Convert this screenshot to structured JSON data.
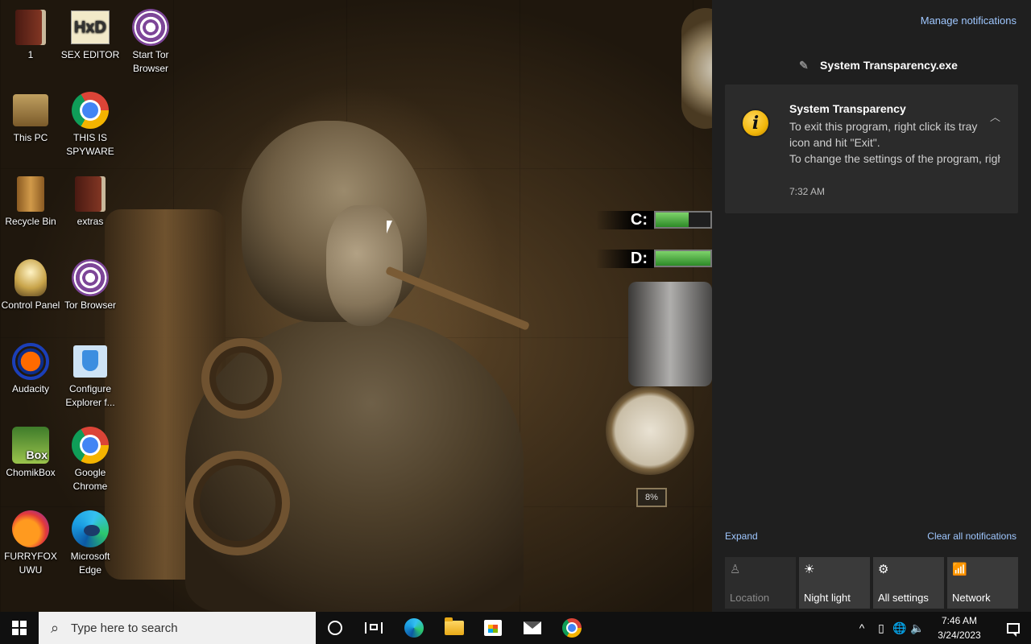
{
  "desktop": {
    "icons": [
      {
        "label": "1",
        "icon": "book-icon"
      },
      {
        "label": "SEX EDITOR",
        "icon": "hxd-icon",
        "glyph": "HxD"
      },
      {
        "label": "Start Tor Browser",
        "icon": "tor-icon"
      },
      {
        "label": "This PC",
        "icon": "computer-icon"
      },
      {
        "label": "THIS IS SPYWARE",
        "icon": "chrome-icon"
      },
      {
        "label": "Recycle Bin",
        "icon": "recycle-bin-icon"
      },
      {
        "label": "extras",
        "icon": "book-icon"
      },
      {
        "label": "Control Panel",
        "icon": "lightbulb-icon"
      },
      {
        "label": "Tor Browser",
        "icon": "tor-icon"
      },
      {
        "label": "Audacity",
        "icon": "audacity-icon"
      },
      {
        "label": "Configure Explorer f...",
        "icon": "shield-icon"
      },
      {
        "label": "ChomikBox",
        "icon": "chomikbox-icon",
        "glyph": "Box"
      },
      {
        "label": "Google Chrome",
        "icon": "chrome-icon"
      },
      {
        "label": "FURRYFOX UWU",
        "icon": "firefox-icon"
      },
      {
        "label": "Microsoft Edge",
        "icon": "edge-icon"
      }
    ],
    "widgets": {
      "drive_c": {
        "label": "C:",
        "fill_fraction": 0.6
      },
      "drive_d": {
        "label": "D:",
        "fill_fraction": 1.0
      },
      "gauge_value": "8%"
    }
  },
  "action_center": {
    "manage_label": "Manage notifications",
    "app_name": "System Transparency.exe",
    "notification": {
      "title": "System Transparency",
      "line1": "To exit this program, right click its tray icon and hit \"Exit\".",
      "line2": "To change the settings of the program, right click the icon and sele",
      "time": "7:32 AM"
    },
    "expand_label": "Expand",
    "clear_label": "Clear all notifications",
    "quick_actions": [
      {
        "label": "Location",
        "icon": "location-icon",
        "glyph": "♙",
        "enabled": false
      },
      {
        "label": "Night light",
        "icon": "brightness-icon",
        "glyph": "☀",
        "enabled": true
      },
      {
        "label": "All settings",
        "icon": "gear-icon",
        "glyph": "⚙",
        "enabled": true
      },
      {
        "label": "Network",
        "icon": "network-icon",
        "glyph": "📶",
        "enabled": true
      }
    ]
  },
  "taskbar": {
    "search_placeholder": "Type here to search",
    "clock_time": "7:46 AM",
    "clock_date": "3/24/2023",
    "tray": {
      "chevron": "^",
      "globe": "🌐",
      "speaker": "🔈"
    }
  },
  "colors": {
    "accent_link": "#9fc7ff",
    "panel_bg": "#1f1f1f",
    "toast_bg": "#2b2b2b"
  }
}
